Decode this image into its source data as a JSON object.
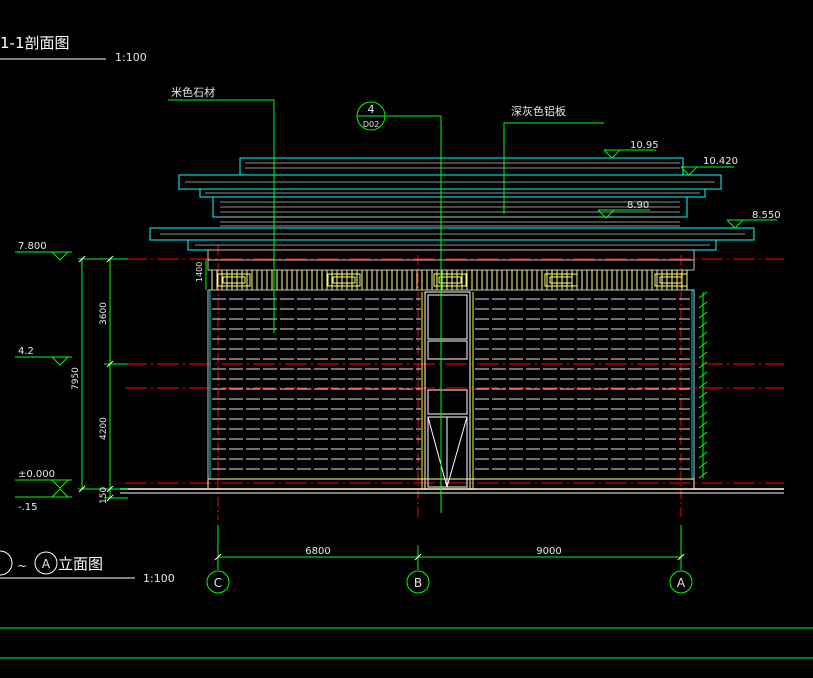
{
  "title_top": {
    "label": "1-1剖面图",
    "scale": "1:100"
  },
  "title_bottom": {
    "axis_a": "A",
    "sep": "~",
    "label": "立面图",
    "scale": "1:100"
  },
  "callouts": {
    "stone": "米色石材",
    "aluminum": "深灰色铝板",
    "detail_num": "4",
    "detail_sheet": "D02"
  },
  "elevations": {
    "e1": "10.95",
    "e2": "10.420",
    "e3": "8.90",
    "e4": "8.550",
    "left1": "7.800",
    "left2": "4.2",
    "left3": "±0.000",
    "left4": "-.15"
  },
  "dims": {
    "v_total": "7950",
    "v_upper": "3600",
    "v_lower": "4200",
    "v_base": "150",
    "v_fascia": "1400",
    "h_left": "6800",
    "h_right": "9000"
  },
  "grid_axes": [
    "C",
    "B",
    "A"
  ],
  "colors": {
    "yellow": "#ffff00",
    "green": "#00ff00",
    "cyan": "#00ffff",
    "red": "#ff0000",
    "white": "#ffffff",
    "gray": "#909090"
  }
}
